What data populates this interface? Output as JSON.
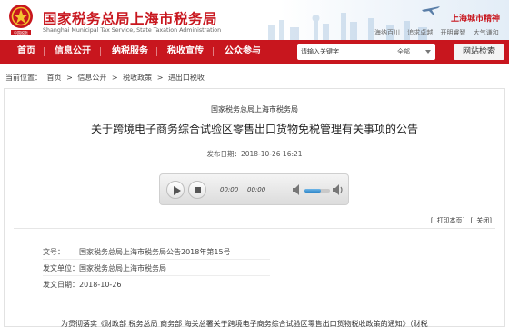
{
  "header": {
    "site_title_cn": "国家税务总局上海市税务局",
    "site_title_en": "Shanghai Municipal Tax Service, State Taxation Administration",
    "city_spirit_label": "上海城市精神",
    "spirit_words": [
      "海纳百川",
      "追求卓越",
      "开明睿智",
      "大气谦和"
    ],
    "brand_color": "#c8161e"
  },
  "nav": {
    "items": [
      "首页",
      "信息公开",
      "纳税服务",
      "税收宣传",
      "公众参与"
    ],
    "search_placeholder": "请输入关键字",
    "search_scope": "全部",
    "search_button": "网站检索"
  },
  "breadcrumb": {
    "prefix": "当前位置：",
    "items": [
      "首页",
      "信息公开",
      "税收政策",
      "进出口税收"
    ],
    "separator": ">"
  },
  "article": {
    "issuer": "国家税务总局上海市税务局",
    "title": "关于跨境电子商务综合试验区零售出口货物免税管理有关事项的公告",
    "publish_label": "发布日期：",
    "publish_time": "2018-10-26 16:21",
    "audio": {
      "current_time": "00:00",
      "total_time": "00:00",
      "volume": 0.65
    },
    "print_link": "打印本页",
    "close_link": "关闭",
    "meta": [
      {
        "label": "文号：",
        "value": "国家税务总局上海市税务局公告2018年第15号"
      },
      {
        "label": "发文单位：",
        "value": "国家税务总局上海市税务局"
      },
      {
        "label": "发文日期：",
        "value": "2018-10-26"
      }
    ],
    "body_first_line": "为贯彻落实《财政部 税务总局 商务部 海关总署关于跨境电子商务综合试验区零售出口货物税收政策的通知》（财税"
  }
}
